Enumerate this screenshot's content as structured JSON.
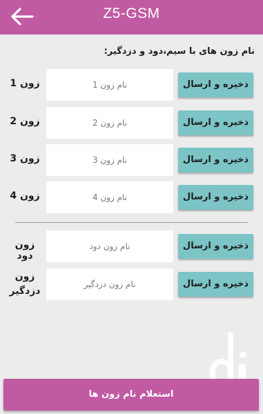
{
  "header": {
    "title": "Z5-GSM",
    "back_icon": "arrow-left-icon",
    "color": "#c05aa3"
  },
  "intro_text": "نام زون های با سیم،دود و دزدگیر:",
  "zones": [
    {
      "label": "زون 1",
      "placeholder": "نام زون 1",
      "value": "",
      "save_label": "ذخیره و ارسال"
    },
    {
      "label": "زون 2",
      "placeholder": "نام زون 2",
      "value": "",
      "save_label": "ذخیره و ارسال"
    },
    {
      "label": "زون 3",
      "placeholder": "نام زون 3",
      "value": "",
      "save_label": "ذخیره و ارسال"
    },
    {
      "label": "زون 4",
      "placeholder": "نام زون 4",
      "value": "",
      "save_label": "ذخیره و ارسال"
    }
  ],
  "special_zones": [
    {
      "label": "زون دود",
      "placeholder": "نام زون دود",
      "value": "",
      "save_label": "ذخیره و ارسال"
    },
    {
      "label": "زون دزدگیر",
      "placeholder": "نام زون دزدگیر",
      "value": "",
      "save_label": "ذخیره و ارسال"
    }
  ],
  "query_button_label": "استعلام نام زون ها",
  "watermark_logo": "bazaar-logo",
  "colors": {
    "accent": "#c05aa3",
    "button": "#7cc4c6",
    "background": "#ececec"
  }
}
